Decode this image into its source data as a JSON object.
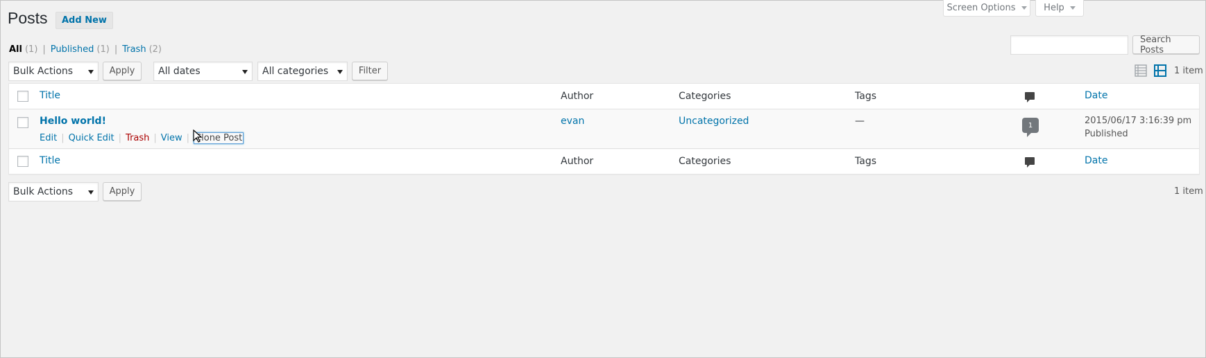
{
  "header": {
    "title": "Posts",
    "add_new": "Add New",
    "screen_options": "Screen Options",
    "help": "Help"
  },
  "filters": {
    "all": "All",
    "all_count": "(1)",
    "published": "Published",
    "published_count": "(1)",
    "trash": "Trash",
    "trash_count": "(2)",
    "separator": "|"
  },
  "search": {
    "value": "",
    "button": "Search Posts"
  },
  "toolbar_top": {
    "bulk_actions": "Bulk Actions",
    "apply": "Apply",
    "dates": "All dates",
    "categories": "All categories",
    "filter": "Filter",
    "items": "1 item"
  },
  "table": {
    "columns": {
      "title": "Title",
      "author": "Author",
      "categories": "Categories",
      "tags": "Tags",
      "date": "Date"
    },
    "rows": [
      {
        "title": "Hello world!",
        "author": "evan",
        "categories": "Uncategorized",
        "tags": "—",
        "comments": "1",
        "date": "2015/06/17 3:16:39 pm",
        "status": "Published",
        "actions": {
          "edit": "Edit",
          "quick_edit": "Quick Edit",
          "trash": "Trash",
          "view": "View",
          "clone": "Clone Post"
        }
      }
    ]
  },
  "toolbar_bottom": {
    "bulk_actions": "Bulk Actions",
    "apply": "Apply",
    "items": "1 item"
  },
  "colors": {
    "link": "#0073aa",
    "trash": "#aa0000",
    "background": "#f1f1f1"
  }
}
